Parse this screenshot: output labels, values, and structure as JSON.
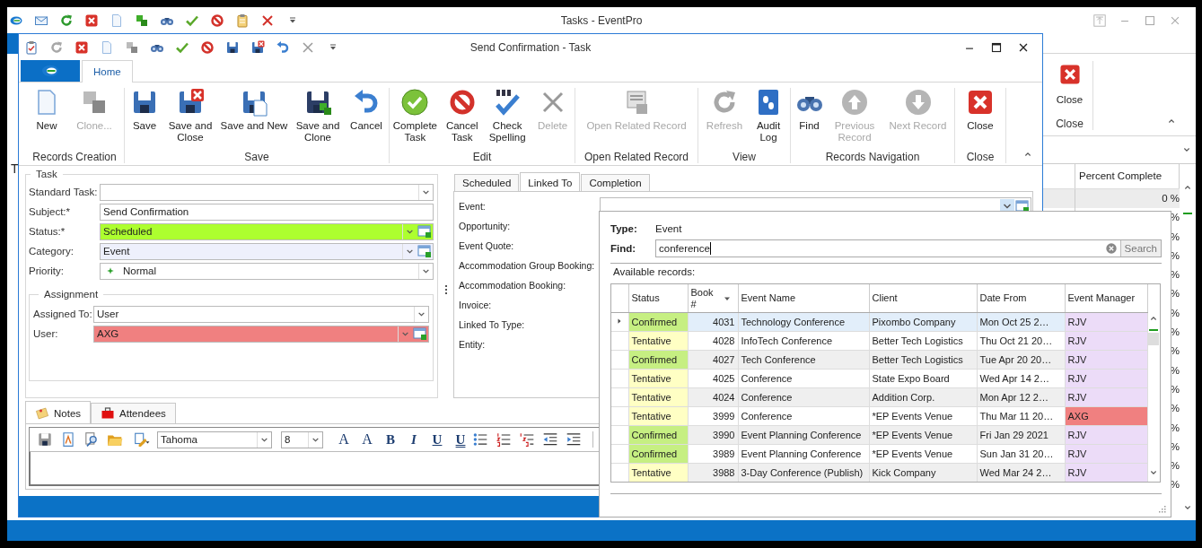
{
  "main_window": {
    "title": "Tasks - EventPro",
    "cut_text": "T",
    "ribbon_button": {
      "label": "Close"
    },
    "ribbon_group": "Close",
    "percent_column": {
      "header": "Percent Complete",
      "cells": [
        {
          "text": "0 %",
          "selected": true
        },
        {
          "text": "%",
          "selected": false
        },
        {
          "text": "%",
          "selected": false
        },
        {
          "text": "%",
          "selected": false
        },
        {
          "text": "%",
          "selected": false
        },
        {
          "text": "%",
          "selected": false
        },
        {
          "text": "%",
          "selected": false
        },
        {
          "text": "%",
          "selected": false
        },
        {
          "text": "%",
          "selected": false
        },
        {
          "text": "%",
          "selected": false
        },
        {
          "text": "%",
          "selected": false
        },
        {
          "text": "%",
          "selected": false
        },
        {
          "text": "%",
          "selected": false
        },
        {
          "text": "%",
          "selected": false
        },
        {
          "text": "%",
          "selected": false
        },
        {
          "text": "%",
          "selected": false
        }
      ]
    }
  },
  "task_window": {
    "title": "Send Confirmation - Task",
    "tabs": [
      {
        "label": "Home",
        "selected": true
      }
    ],
    "ribbon_groups": [
      {
        "label": "Records Creation",
        "buttons": [
          {
            "label": "New",
            "disabled": false
          },
          {
            "label": "Clone...",
            "disabled": true
          }
        ]
      },
      {
        "label": "Save",
        "buttons": [
          {
            "label": "Save",
            "disabled": false
          },
          {
            "label": "Save and Close",
            "disabled": false
          },
          {
            "label": "Save and New",
            "disabled": false
          },
          {
            "label": "Save and Clone",
            "disabled": false
          },
          {
            "label": "Cancel",
            "disabled": false
          }
        ]
      },
      {
        "label": "Edit",
        "buttons": [
          {
            "label": "Complete Task",
            "disabled": false
          },
          {
            "label": "Cancel Task",
            "disabled": false
          },
          {
            "label": "Check Spelling",
            "disabled": false
          },
          {
            "label": "Delete",
            "disabled": true
          }
        ]
      },
      {
        "label": "Open Related Record",
        "buttons": [
          {
            "label": "Open Related Record",
            "disabled": true
          }
        ]
      },
      {
        "label": "View",
        "buttons": [
          {
            "label": "Refresh",
            "disabled": true
          },
          {
            "label": "Audit Log",
            "disabled": false
          }
        ]
      },
      {
        "label": "Records Navigation",
        "buttons": [
          {
            "label": "Find",
            "disabled": false
          },
          {
            "label": "Previous Record",
            "disabled": true
          },
          {
            "label": "Next Record",
            "disabled": true
          }
        ]
      },
      {
        "label": "Close",
        "buttons": [
          {
            "label": "Close",
            "disabled": false
          }
        ]
      }
    ],
    "task_group": {
      "title": "Task",
      "fields": [
        {
          "label": "Standard Task:",
          "kind": "combo"
        },
        {
          "label": "Subject:*",
          "kind": "text",
          "value": "Send Confirmation"
        },
        {
          "label": "Status:*",
          "kind": "lookup",
          "value": "Scheduled",
          "color": "#adff2f"
        },
        {
          "label": "Category:",
          "kind": "lookup",
          "value": "Event",
          "color": "#eef0fc"
        },
        {
          "label": "Priority:",
          "kind": "combo-icon",
          "value": "Normal"
        }
      ],
      "assignment": {
        "title": "Assignment",
        "fields": [
          {
            "label": "Assigned To:",
            "kind": "combo",
            "value": "User"
          },
          {
            "label": "User:",
            "kind": "lookup",
            "value": "AXG",
            "color": "#f08080"
          }
        ]
      }
    },
    "link_tabs": [
      {
        "label": "Scheduled",
        "selected": false
      },
      {
        "label": "Linked To",
        "selected": true
      },
      {
        "label": "Completion",
        "selected": false
      }
    ],
    "link_fields": [
      "Event:",
      "Opportunity:",
      "Event Quote:",
      "Accommodation Group Booking:",
      "Accommodation Booking:",
      "Invoice:",
      "Linked To Type:",
      "Entity:"
    ],
    "notes_tabs": [
      {
        "label": "Notes",
        "selected": true
      },
      {
        "label": "Attendees",
        "selected": false
      }
    ],
    "editor": {
      "font": "Tahoma",
      "size": "8",
      "format_buttons": [
        "A",
        "A",
        "B",
        "I",
        "U",
        "U"
      ]
    }
  },
  "event_popup": {
    "type_label": "Type:",
    "type_value": "Event",
    "find_label": "Find:",
    "find_value": "conference",
    "search_button": "Search",
    "available_label": "Available records:",
    "columns": [
      {
        "label": "Status",
        "sorted": false
      },
      {
        "label": "Book #",
        "sorted": true
      },
      {
        "label": "Event Name",
        "sorted": false
      },
      {
        "label": "Client",
        "sorted": false
      },
      {
        "label": "Date From",
        "sorted": false
      },
      {
        "label": "Event Manager",
        "sorted": false
      }
    ],
    "rows": [
      {
        "selected": true,
        "status": {
          "text": "Confirmed",
          "color": "#c6ef82"
        },
        "book": "4031",
        "event_name": "Technology Conference",
        "client": "Pixombo Company",
        "date_from": "Mon Oct 25 2…",
        "manager": {
          "text": "RJV",
          "color": "#ecdcf8"
        }
      },
      {
        "selected": false,
        "status": {
          "text": "Tentative",
          "color": "#ffffc4"
        },
        "book": "4028",
        "event_name": "InfoTech Conference",
        "client": "Better Tech Logistics",
        "date_from": "Thu Oct 21 20…",
        "manager": {
          "text": "RJV",
          "color": "#ecdcf8"
        }
      },
      {
        "selected": false,
        "status": {
          "text": "Confirmed",
          "color": "#c6ef82"
        },
        "book": "4027",
        "event_name": "Tech Conference",
        "client": "Better Tech Logistics",
        "date_from": "Tue Apr 20 20…",
        "manager": {
          "text": "RJV",
          "color": "#ecdcf8"
        }
      },
      {
        "selected": false,
        "status": {
          "text": "Tentative",
          "color": "#ffffc4"
        },
        "book": "4025",
        "event_name": "Conference",
        "client": "State Expo Board",
        "date_from": "Wed Apr 14 2…",
        "manager": {
          "text": "RJV",
          "color": "#ecdcf8"
        }
      },
      {
        "selected": false,
        "status": {
          "text": "Tentative",
          "color": "#ffffc4"
        },
        "book": "4024",
        "event_name": "Conference",
        "client": "Addition Corp.",
        "date_from": "Mon Apr 12 2…",
        "manager": {
          "text": "RJV",
          "color": "#ecdcf8"
        }
      },
      {
        "selected": false,
        "status": {
          "text": "Tentative",
          "color": "#ffffc4"
        },
        "book": "3999",
        "event_name": "Conference",
        "client": "*EP Events Venue",
        "date_from": "Thu Mar 11 20…",
        "manager": {
          "text": "AXG",
          "color": "#f08080"
        }
      },
      {
        "selected": false,
        "status": {
          "text": "Confirmed",
          "color": "#c6ef82"
        },
        "book": "3990",
        "event_name": "Event Planning Conference",
        "client": "*EP Events Venue",
        "date_from": "Fri Jan 29 2021",
        "manager": {
          "text": "RJV",
          "color": "#ecdcf8"
        }
      },
      {
        "selected": false,
        "status": {
          "text": "Confirmed",
          "color": "#c6ef82"
        },
        "book": "3989",
        "event_name": "Event Planning Conference",
        "client": "*EP Events Venue",
        "date_from": "Sun Jan 31 20…",
        "manager": {
          "text": "RJV",
          "color": "#ecdcf8"
        }
      },
      {
        "selected": false,
        "status": {
          "text": "Tentative",
          "color": "#ffffc4"
        },
        "book": "3988",
        "event_name": "3-Day Conference (Publish)",
        "client": "Kick Company",
        "date_from": "Wed Mar 24 2…",
        "manager": {
          "text": "RJV",
          "color": "#ecdcf8"
        }
      }
    ]
  }
}
